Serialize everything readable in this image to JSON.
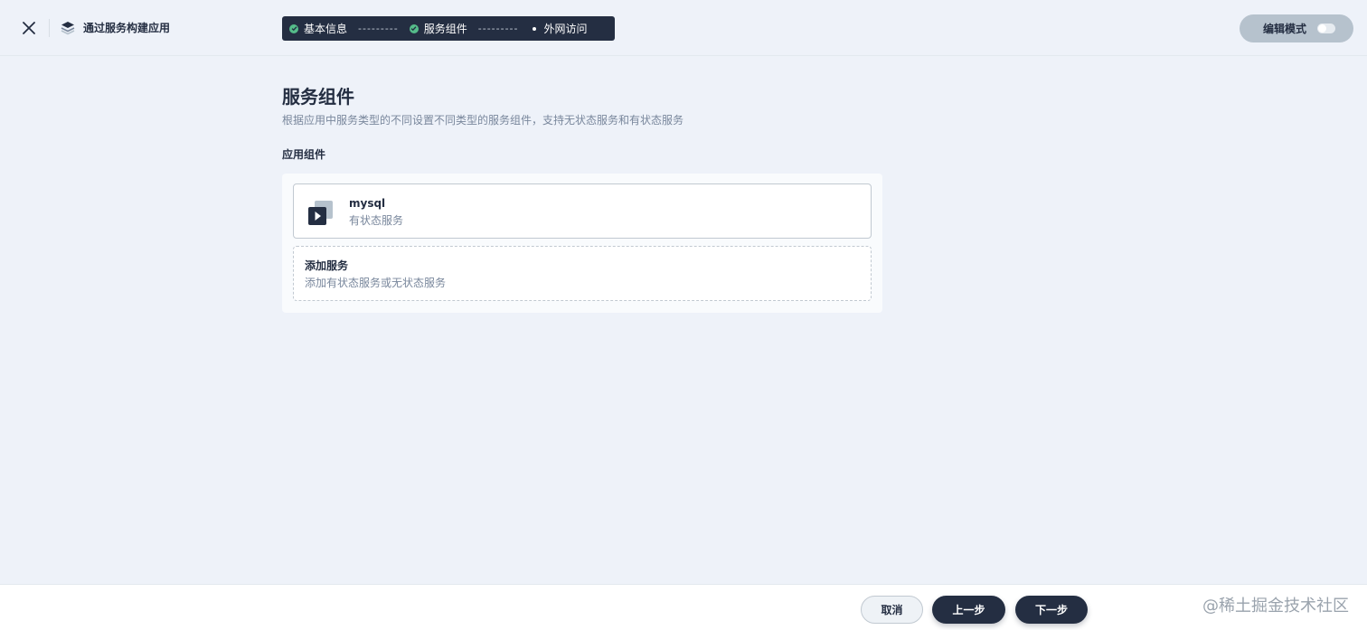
{
  "header": {
    "app_title": "通过服务构建应用",
    "steps": [
      {
        "label": "基本信息",
        "state": "done"
      },
      {
        "label": "服务组件",
        "state": "done"
      },
      {
        "label": "外网访问",
        "state": "current"
      }
    ],
    "step_separator": "---------",
    "edit_mode_label": "编辑模式",
    "edit_mode_on": false
  },
  "main": {
    "title": "服务组件",
    "description": "根据应用中服务类型的不同设置不同类型的服务组件，支持无状态服务和有状态服务",
    "section_label": "应用组件",
    "services": [
      {
        "name": "mysql",
        "type": "有状态服务",
        "icon": "stateful-service-icon"
      }
    ],
    "add_service": {
      "title": "添加服务",
      "description": "添加有状态服务或无状态服务"
    }
  },
  "footer": {
    "cancel_label": "取消",
    "prev_label": "上一步",
    "next_label": "下一步",
    "watermark": "@稀土掘金技术社区"
  },
  "colors": {
    "background": "#eef2f9",
    "dark": "#242e42",
    "success": "#55bc8a",
    "muted_text": "#79879c"
  }
}
